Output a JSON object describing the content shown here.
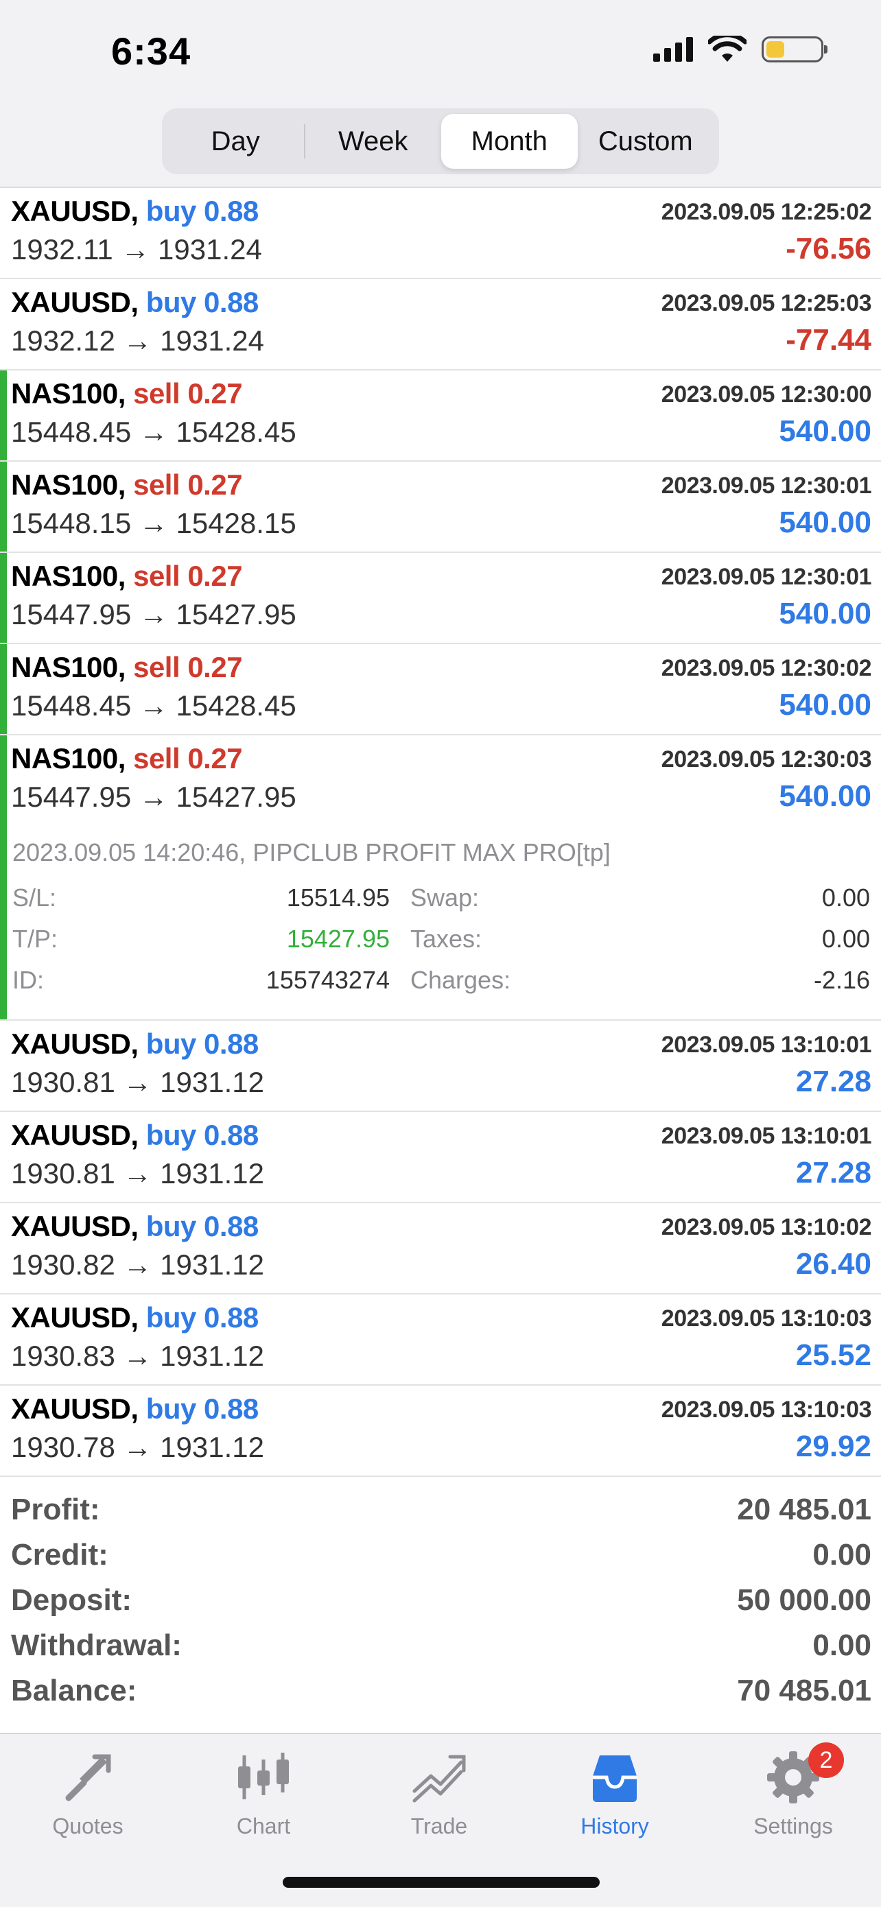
{
  "status": {
    "time": "6:34"
  },
  "segments": [
    {
      "label": "Day",
      "active": false
    },
    {
      "label": "Week",
      "active": false
    },
    {
      "label": "Month",
      "active": true
    },
    {
      "label": "Custom",
      "active": false
    }
  ],
  "trades": [
    {
      "symbol": "XAUUSD,",
      "side": "buy",
      "volume": "0.88",
      "datetime": "2023.09.05 12:25:02",
      "prices": "1932.11 → 1931.24",
      "profit": "-76.56"
    },
    {
      "symbol": "XAUUSD,",
      "side": "buy",
      "volume": "0.88",
      "datetime": "2023.09.05 12:25:03",
      "prices": "1932.12 → 1931.24",
      "profit": "-77.44"
    },
    {
      "symbol": "NAS100,",
      "side": "sell",
      "volume": "0.27",
      "datetime": "2023.09.05 12:30:00",
      "prices": "15448.45 → 15428.45",
      "profit": "540.00"
    },
    {
      "symbol": "NAS100,",
      "side": "sell",
      "volume": "0.27",
      "datetime": "2023.09.05 12:30:01",
      "prices": "15448.15 → 15428.15",
      "profit": "540.00"
    },
    {
      "symbol": "NAS100,",
      "side": "sell",
      "volume": "0.27",
      "datetime": "2023.09.05 12:30:01",
      "prices": "15447.95 → 15427.95",
      "profit": "540.00"
    },
    {
      "symbol": "NAS100,",
      "side": "sell",
      "volume": "0.27",
      "datetime": "2023.09.05 12:30:02",
      "prices": "15448.45 → 15428.45",
      "profit": "540.00"
    }
  ],
  "expanded_trade": {
    "symbol": "NAS100,",
    "side": "sell",
    "volume": "0.27",
    "datetime": "2023.09.05 12:30:03",
    "prices": "15447.95 → 15427.95",
    "profit": "540.00",
    "comment": "2023.09.05 14:20:46, PIPCLUB PROFIT MAX PRO[tp]",
    "sl_label": "S/L:",
    "sl_value": "15514.95",
    "tp_label": "T/P:",
    "tp_value": "15427.95",
    "id_label": "ID:",
    "id_value": "155743274",
    "swap_label": "Swap:",
    "swap_value": "0.00",
    "taxes_label": "Taxes:",
    "taxes_value": "0.00",
    "charges_label": "Charges:",
    "charges_value": "-2.16"
  },
  "trades2": [
    {
      "symbol": "XAUUSD,",
      "side": "buy",
      "volume": "0.88",
      "datetime": "2023.09.05 13:10:01",
      "prices": "1930.81 → 1931.12",
      "profit": "27.28"
    },
    {
      "symbol": "XAUUSD,",
      "side": "buy",
      "volume": "0.88",
      "datetime": "2023.09.05 13:10:01",
      "prices": "1930.81 → 1931.12",
      "profit": "27.28"
    },
    {
      "symbol": "XAUUSD,",
      "side": "buy",
      "volume": "0.88",
      "datetime": "2023.09.05 13:10:02",
      "prices": "1930.82 → 1931.12",
      "profit": "26.40"
    },
    {
      "symbol": "XAUUSD,",
      "side": "buy",
      "volume": "0.88",
      "datetime": "2023.09.05 13:10:03",
      "prices": "1930.83 → 1931.12",
      "profit": "25.52"
    },
    {
      "symbol": "XAUUSD,",
      "side": "buy",
      "volume": "0.88",
      "datetime": "2023.09.05 13:10:03",
      "prices": "1930.78 → 1931.12",
      "profit": "29.92"
    }
  ],
  "summary": [
    {
      "label": "Profit:",
      "value": "20 485.01"
    },
    {
      "label": "Credit:",
      "value": "0.00"
    },
    {
      "label": "Deposit:",
      "value": "50 000.00"
    },
    {
      "label": "Withdrawal:",
      "value": "0.00"
    },
    {
      "label": "Balance:",
      "value": "70 485.01"
    }
  ],
  "tabs": [
    {
      "label": "Quotes",
      "icon": "quotes-icon",
      "active": false
    },
    {
      "label": "Chart",
      "icon": "chart-icon",
      "active": false
    },
    {
      "label": "Trade",
      "icon": "trade-icon",
      "active": false
    },
    {
      "label": "History",
      "icon": "history-icon",
      "active": true
    },
    {
      "label": "Settings",
      "icon": "settings-icon",
      "active": false,
      "badge": "2"
    }
  ],
  "colors": {
    "buy": "#2f7ae5",
    "sell": "#d03a2c",
    "highlight": "#33b03a",
    "badge": "#e8372e"
  }
}
